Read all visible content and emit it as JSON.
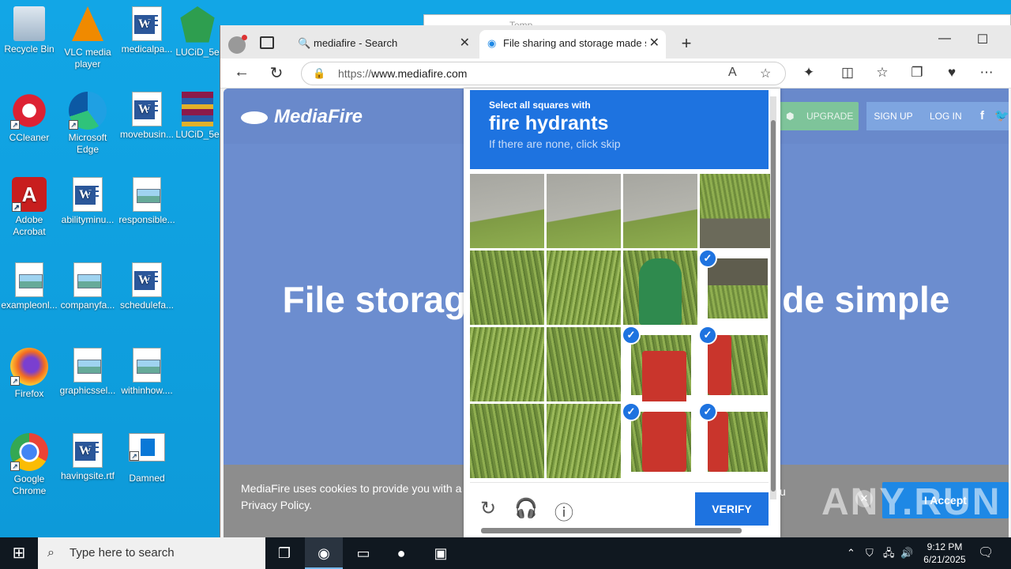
{
  "desktop": {
    "icons": [
      {
        "label": "Recycle Bin"
      },
      {
        "label": "VLC media player"
      },
      {
        "label": "medicalpa..."
      },
      {
        "label": "LUCiD_5e"
      },
      {
        "label": "CCleaner"
      },
      {
        "label": "Microsoft Edge"
      },
      {
        "label": "movebusin..."
      },
      {
        "label": "LUCiD_5e"
      },
      {
        "label": "Adobe Acrobat"
      },
      {
        "label": "abilityminu..."
      },
      {
        "label": "responsible..."
      },
      {
        "label": "exampleonl..."
      },
      {
        "label": "companyfa..."
      },
      {
        "label": "schedulefa..."
      },
      {
        "label": "Firefox"
      },
      {
        "label": "graphicssel..."
      },
      {
        "label": "withinhow...."
      },
      {
        "label": "Google Chrome"
      },
      {
        "label": "havingsite.rtf"
      },
      {
        "label": "Damned"
      }
    ],
    "bg_window_title": "Temp"
  },
  "browser": {
    "tabs": [
      {
        "label": "mediafire - Search",
        "icon": "search-icon"
      },
      {
        "label": "File sharing and storage made sin",
        "icon": "edge-icon"
      }
    ],
    "url_scheme": "https://",
    "url_host": "www.mediafire.com"
  },
  "mediafire": {
    "logo": "MediaFire",
    "upgrade": "UPGRADE",
    "signup": "SIGN UP",
    "login": "LOG IN",
    "hero_left": "File storag",
    "hero_right": "de simple",
    "cookie_text": "MediaFire uses cookies to provide you with a p agree to our Privacy Policy.",
    "cookie_tail": "u",
    "accept": "I Accept"
  },
  "captcha": {
    "line1": "Select all squares with",
    "line2": "fire hydrants",
    "line3": "If there are none, click skip",
    "verify": "VERIFY",
    "selected_cells": [
      7,
      10,
      11,
      14,
      15
    ]
  },
  "watermark": "ANY.RUN",
  "taskbar": {
    "search_placeholder": "Type here to search",
    "time": "9:12 PM",
    "date": "6/21/2025"
  }
}
